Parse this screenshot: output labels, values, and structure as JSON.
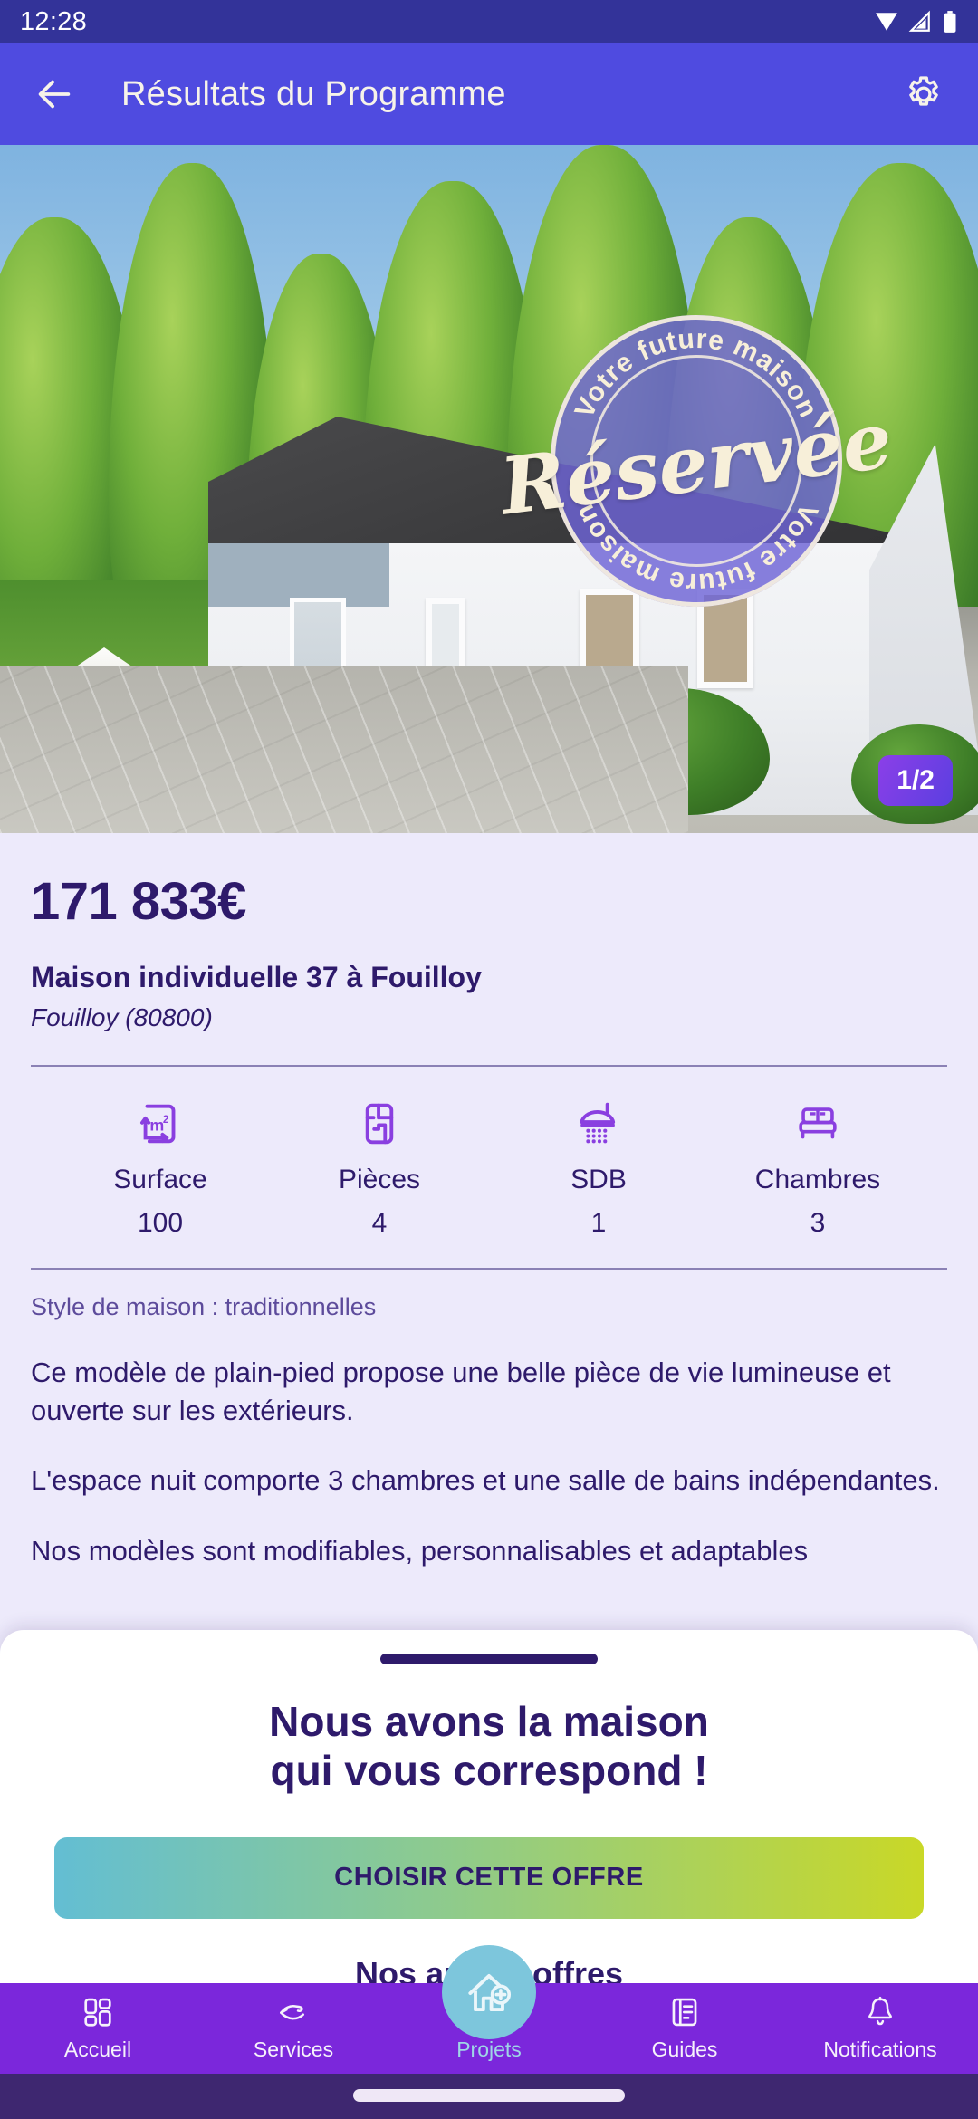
{
  "status_bar": {
    "time": "12:28",
    "icons": [
      "wifi-icon",
      "signal-icon",
      "battery-icon"
    ],
    "bg": "#333399"
  },
  "app_bar": {
    "title": "Résultats du Programme",
    "back_icon": "arrow-left-icon",
    "settings_icon": "gear-icon",
    "bg": "#4F4BE0",
    "text_color": "#F7F3E9"
  },
  "hero": {
    "stamp": {
      "arc_top": "Votre future maison",
      "arc_bottom": "Votre future maison",
      "script": "Réservée",
      "bg": "#6E64D6",
      "ink": "#F7EFD9"
    },
    "pager": {
      "label": "1/2",
      "bg": "#7B3FE4"
    }
  },
  "listing": {
    "price": "171 833€",
    "title": "Maison individuelle 37 à Fouilloy",
    "city": "Fouilloy (80800)",
    "style_line": "Style de maison : traditionnelles",
    "paragraphs": [
      "Ce modèle de plain-pied propose une belle pièce de vie lumineuse et ouverte sur les extérieurs.",
      "L'espace nuit comporte 3 chambres et une salle de bains indépendantes.",
      "Nos modèles sont modifiables, personnalisables et adaptables"
    ],
    "specs": [
      {
        "icon": "surface-m2-icon",
        "label": "Surface",
        "value": "100"
      },
      {
        "icon": "floorplan-rooms-icon",
        "label": "Pièces",
        "value": "4"
      },
      {
        "icon": "shower-icon",
        "label": "SDB",
        "value": "1"
      },
      {
        "icon": "bed-icon",
        "label": "Chambres",
        "value": "3"
      }
    ],
    "accent": "#2E1A6B",
    "bg": "#EDEAFB"
  },
  "sheet": {
    "grabber": "drag-handle",
    "headline_line1": "Nous avons la maison",
    "headline_line2": "qui vous correspond !",
    "cta_label": "CHOISIR CETTE OFFRE",
    "cta_gradient_from": "#63BED3",
    "cta_gradient_to": "#C9D827",
    "more_label": "Nos autres offres"
  },
  "bottom_nav": {
    "bg": "#7B27DB",
    "active_color": "#9FD6E6",
    "items": [
      {
        "icon": "grid-icon",
        "label": "Accueil",
        "active": false
      },
      {
        "icon": "handshake-icon",
        "label": "Services",
        "active": false
      },
      {
        "icon": "house-plus-icon",
        "label": "Projets",
        "active": true
      },
      {
        "icon": "document-list-icon",
        "label": "Guides",
        "active": false
      },
      {
        "icon": "bell-icon",
        "label": "Notifications",
        "active": false
      }
    ],
    "fab_icon": "house-plus-fab-icon",
    "fab_bg": "#7DC6DC"
  },
  "gesture_bar": {
    "bg": "#3E2770"
  }
}
